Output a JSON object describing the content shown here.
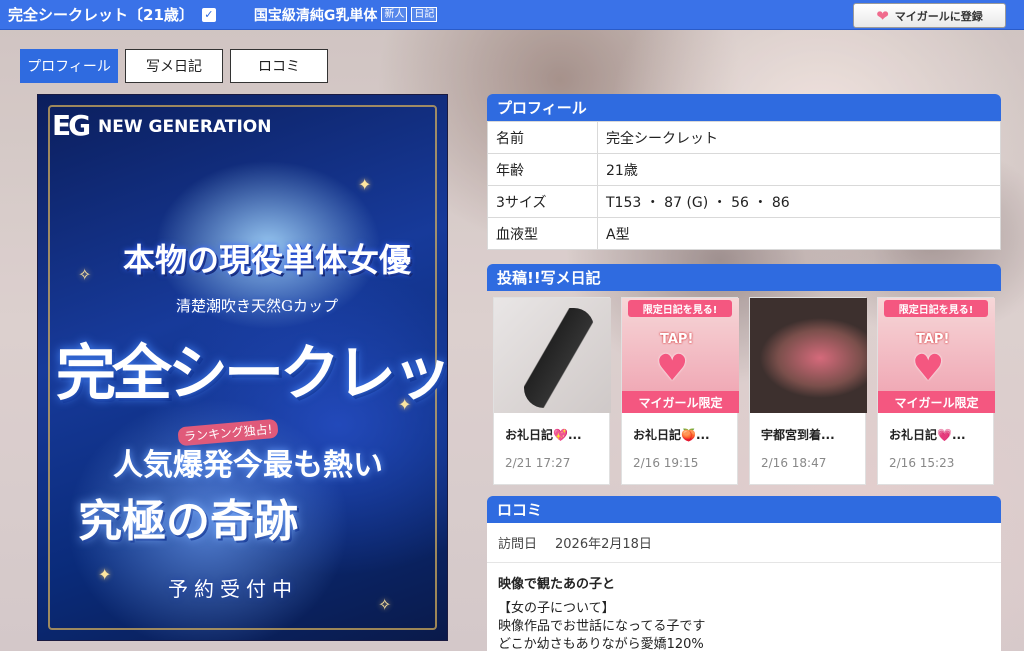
{
  "header": {
    "name": "完全シークレット〔21歳〕",
    "catch": "国宝級清純G乳単体",
    "tags": [
      "新人",
      "日記"
    ],
    "mygirl_button": "マイガールに登録"
  },
  "tabs": [
    {
      "label": "プロフィール",
      "active": true
    },
    {
      "label": "写メ日記",
      "active": false
    },
    {
      "label": "ロコミ",
      "active": false
    }
  ],
  "poster": {
    "logo": "EG",
    "brand": "NEW GENERATION",
    "lines": [
      "本物の現役単体女優",
      "清楚潮吹き天然Gカップ",
      "完全シークレット",
      "ランキング独占!",
      "人気爆発今最も熱い",
      "究極の奇跡",
      "予約受付中"
    ]
  },
  "profile": {
    "heading": "プロフィール",
    "rows": [
      {
        "key": "名前",
        "value": "完全シークレット"
      },
      {
        "key": "年齢",
        "value": "21歳"
      },
      {
        "key": "3サイズ",
        "value": "T153 ・ 87 (G) ・ 56 ・ 86"
      },
      {
        "key": "血液型",
        "value": "A型"
      }
    ]
  },
  "diary": {
    "heading": "投稿!!写メ日記",
    "items": [
      {
        "title": "お礼日記💖...",
        "date": "2/21 17:27"
      },
      {
        "title": "お礼日記🍑...",
        "date": "2/16 19:15",
        "badge_top": "限定日記を見る!",
        "badge_bottom": "マイガール限定",
        "tap": "TAP!"
      },
      {
        "title": "宇都宮到着...",
        "date": "2/16 18:47"
      },
      {
        "title": "お礼日記💗...",
        "date": "2/16 15:23",
        "badge_top": "限定日記を見る!",
        "badge_bottom": "マイガール限定",
        "tap": "TAP!"
      }
    ]
  },
  "review": {
    "heading": "ロコミ",
    "visit_label": "訪問日",
    "visit_date": "2026年2月18日",
    "title": "映像で観たあの子と",
    "text_lines": [
      "【女の子について】",
      "映像作品でお世話になってる子です",
      "どこか幼さもありながら愛嬌120%"
    ]
  }
}
